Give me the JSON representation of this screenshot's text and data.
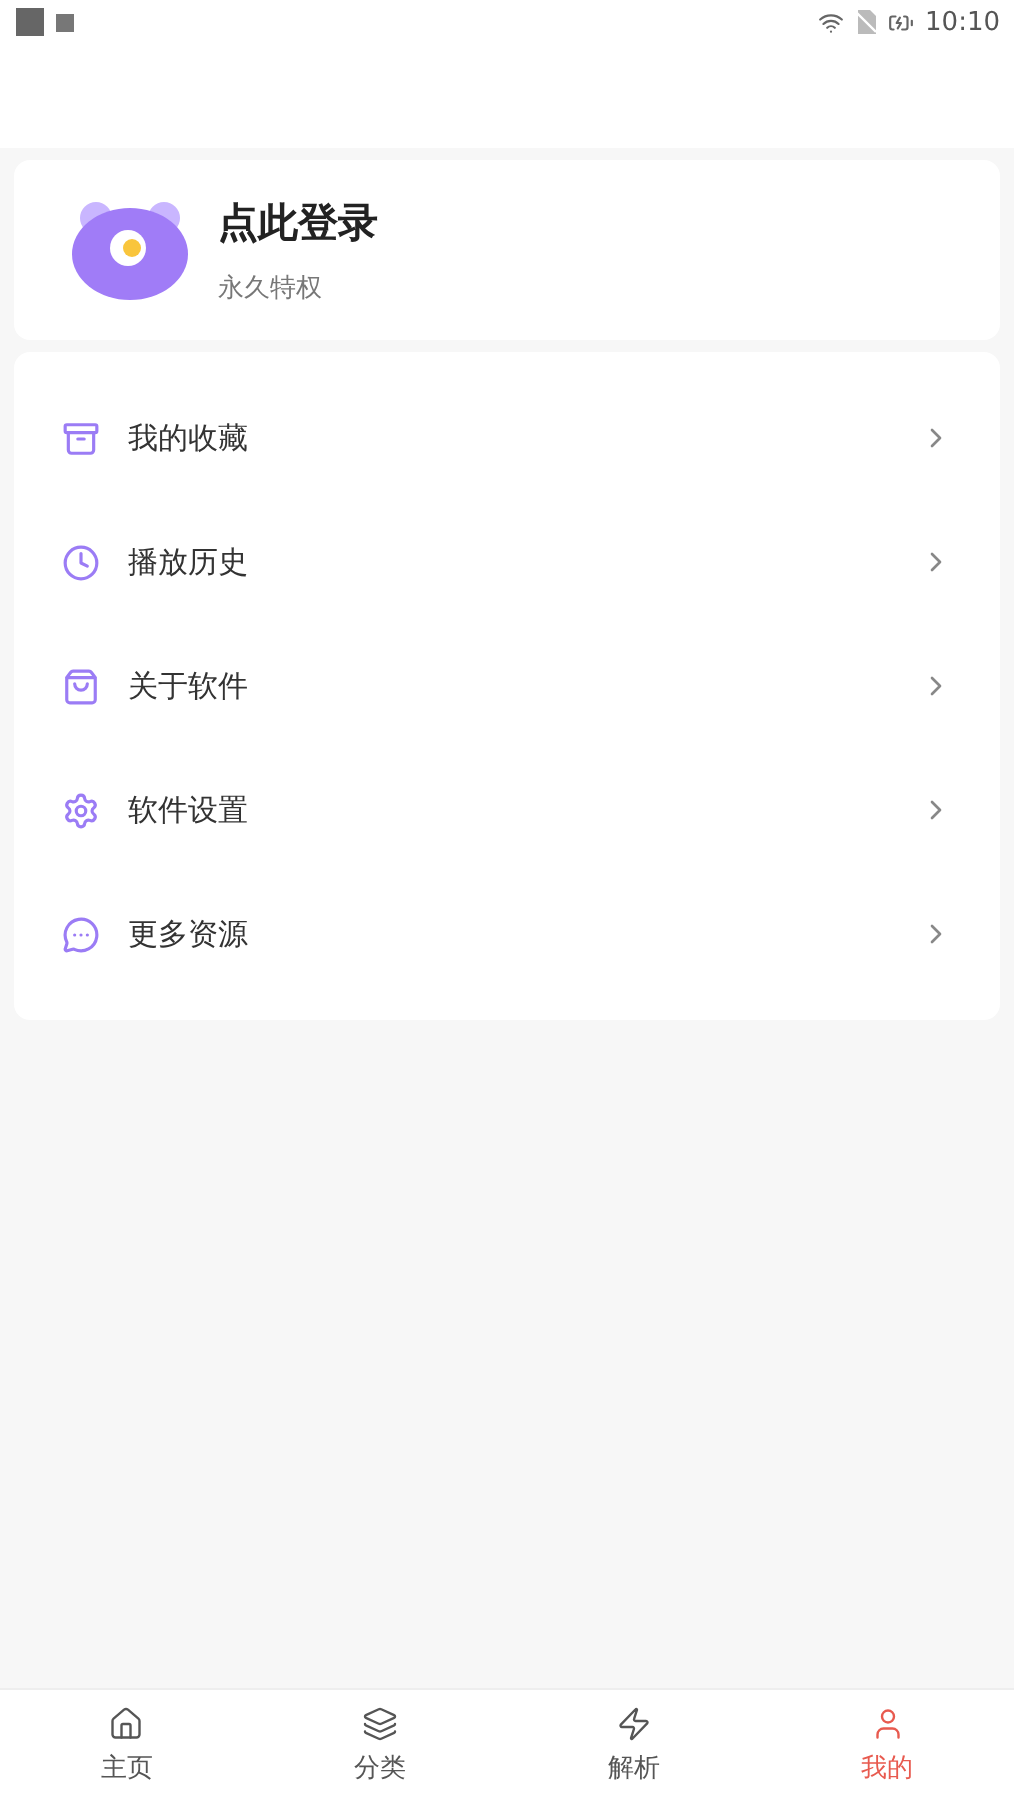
{
  "status_bar": {
    "time": "10:10"
  },
  "profile": {
    "title": "点此登录",
    "subtitle": "永久特权"
  },
  "menu": [
    {
      "kind": "archive",
      "label": "我的收藏"
    },
    {
      "kind": "clock",
      "label": "播放历史"
    },
    {
      "kind": "bag",
      "label": "关于软件"
    },
    {
      "kind": "gear",
      "label": "软件设置"
    },
    {
      "kind": "chat",
      "label": "更多资源"
    }
  ],
  "tabs": [
    {
      "kind": "home",
      "label": "主页",
      "selected": false
    },
    {
      "kind": "layers",
      "label": "分类",
      "selected": false
    },
    {
      "kind": "bolt",
      "label": "解析",
      "selected": false
    },
    {
      "kind": "user",
      "label": "我的",
      "selected": true
    }
  ]
}
